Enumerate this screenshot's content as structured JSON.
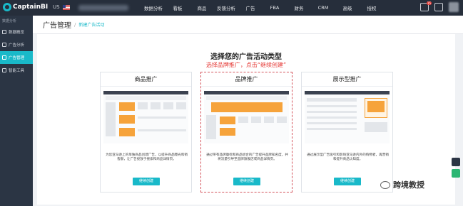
{
  "topbar": {
    "logo": "CaptainBI",
    "store_code": "US",
    "nav": [
      "数据分析",
      "看板",
      "商品",
      "反馈分析",
      "广告",
      "FBA",
      "财务",
      "CRM",
      "高级",
      "授权"
    ],
    "badge_count": "15",
    "accent": "#19b9c9"
  },
  "sidebar": {
    "top_label": "数据分析",
    "items": [
      {
        "label": "数据概览",
        "icon": "grid-icon"
      },
      {
        "label": "广告分析",
        "icon": "chart-icon"
      },
      {
        "label": "广告管理",
        "icon": "ad-icon"
      },
      {
        "label": "智能工具",
        "icon": "tool-icon"
      }
    ],
    "active_index": 2
  },
  "header": {
    "title": "广告管理",
    "separator": "/",
    "breadcrumb": "新建广告活动"
  },
  "main": {
    "heading": "选择您的广告活动类型",
    "instruction": "选择品牌推广，点击“继续创建”",
    "cards": [
      {
        "title": "商品推广",
        "description": "为您亚马逊上的单独商品创建广告，以提升商品曝光和销售额，让广告投放于搜索和商品详情页。",
        "button": "继续创建",
        "selected": false
      },
      {
        "title": "品牌推广",
        "description": "通过带有品牌徽标和商品组合的广告提升品牌知名度，并将流量引导至品牌旗舰店或商品详情页。",
        "button": "继续创建",
        "selected": true
      },
      {
        "title": "展示型推广",
        "description": "通过展示型广告吸引和影响亚马逊内外的购物者，再营销和提升商品认知度。",
        "button": "继续创建",
        "selected": false
      }
    ]
  },
  "watermark": "跨境教授"
}
